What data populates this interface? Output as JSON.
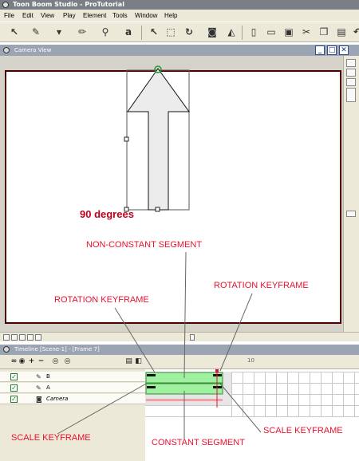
{
  "window": {
    "title": "Toon Boom Studio - ProTutorial"
  },
  "menu": [
    "File",
    "Edit",
    "View",
    "Play",
    "Element",
    "Tools",
    "Window",
    "Help"
  ],
  "camera_view": {
    "title": "Camera View"
  },
  "timeline": {
    "title": "Timeline [Scene-1] - [Frame 7]",
    "ruler_mark": "10",
    "layers": [
      {
        "name": "B",
        "checked": true
      },
      {
        "name": "A",
        "checked": true
      },
      {
        "name": "Camera",
        "checked": true
      }
    ]
  },
  "annotations": {
    "degrees": "90 degrees",
    "non_constant": "NON-CONSTANT SEGMENT",
    "rotation_kf_right": "ROTATION KEYFRAME",
    "rotation_kf_left": "ROTATION KEYFRAME",
    "scale_kf_left": "SCALE KEYFRAME",
    "constant": "CONSTANT SEGMENT",
    "scale_kf_right": "SCALE KEYFRAME"
  },
  "colors": {
    "annotation": "#e8112d",
    "segment_fill": "#9ff09f",
    "keyframe_marker": "#e8112d"
  },
  "icons": {
    "toolbar": [
      "select-arrow-icon",
      "brush-icon",
      "paint-bucket-icon",
      "pencil-icon",
      "zoom-icon",
      "text-icon",
      "pointer-icon",
      "marquee-icon",
      "rotate-icon",
      "camera-icon",
      "eraser-icon",
      "new-icon",
      "open-icon",
      "save-icon",
      "cut-icon",
      "copy-icon",
      "undo-icon"
    ]
  }
}
